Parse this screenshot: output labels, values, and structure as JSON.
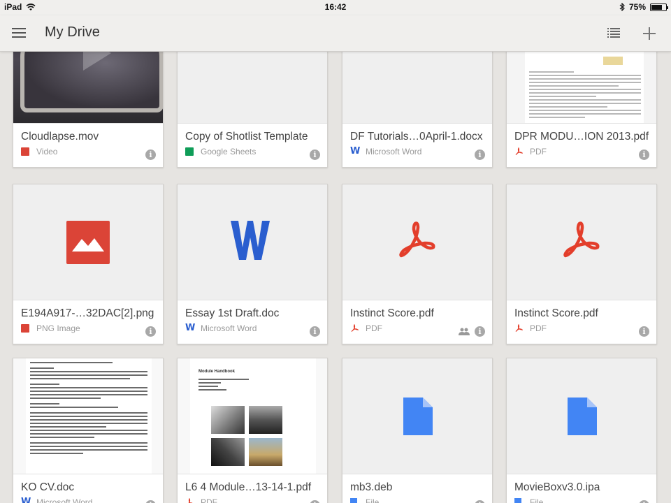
{
  "status": {
    "device": "iPad",
    "time": "16:42",
    "battery": "75%",
    "battery_level": 0.75
  },
  "app": {
    "title": "My Drive"
  },
  "colors": {
    "video": "#db4437",
    "sheets": "#0f9d58",
    "word": "#2a5ecf",
    "pdf": "#e33e2b",
    "file": "#4285f4"
  },
  "files": [
    {
      "name": "Cloudlapse.mov",
      "type": "Video",
      "icon": "video-icon"
    },
    {
      "name": "Copy of Shotlist Template",
      "type": "Google Sheets",
      "icon": "sheets-icon"
    },
    {
      "name": "DF Tutorials…0April-1.docx",
      "type": "Microsoft Word",
      "icon": "word-icon"
    },
    {
      "name": "DPR MODU…ION 2013.pdf",
      "type": "PDF",
      "icon": "pdf-icon"
    },
    {
      "name": "E194A917-…32DAC[2].png",
      "type": "PNG Image",
      "icon": "image-icon"
    },
    {
      "name": "Essay 1st Draft.doc",
      "type": "Microsoft Word",
      "icon": "word-icon"
    },
    {
      "name": "Instinct Score.pdf",
      "type": "PDF",
      "icon": "pdf-icon",
      "shared": true
    },
    {
      "name": "Instinct Score.pdf",
      "type": "PDF",
      "icon": "pdf-icon"
    },
    {
      "name": "KO CV.doc",
      "type": "Microsoft Word",
      "icon": "word-icon"
    },
    {
      "name": "L6 4 Module…13-14-1.pdf",
      "type": "PDF",
      "icon": "pdf-icon"
    },
    {
      "name": "mb3.deb",
      "type": "File",
      "icon": "file-icon"
    },
    {
      "name": "MovieBoxv3.0.ipa",
      "type": "File",
      "icon": "file-icon"
    }
  ],
  "thumbs": {
    "module_title": "Module Handbook"
  }
}
